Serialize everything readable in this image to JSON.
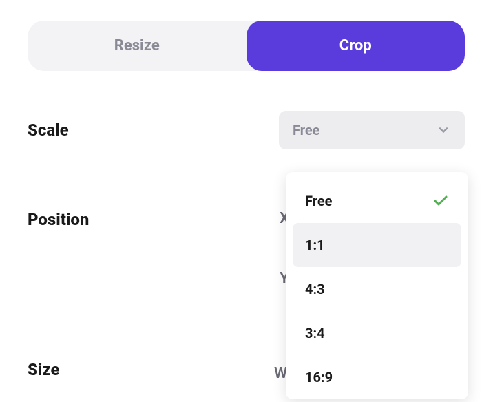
{
  "tabs": {
    "resize": "Resize",
    "crop": "Crop"
  },
  "labels": {
    "scale": "Scale",
    "position": "Position",
    "size": "Size"
  },
  "scale_select": {
    "value": "Free"
  },
  "dropdown": {
    "items": [
      {
        "label": "Free",
        "selected": true
      },
      {
        "label": "1:1",
        "selected": false
      },
      {
        "label": "4:3",
        "selected": false
      },
      {
        "label": "3:4",
        "selected": false
      },
      {
        "label": "16:9",
        "selected": false
      }
    ]
  },
  "partial": {
    "x": "X",
    "y": "Y",
    "w": "W"
  }
}
